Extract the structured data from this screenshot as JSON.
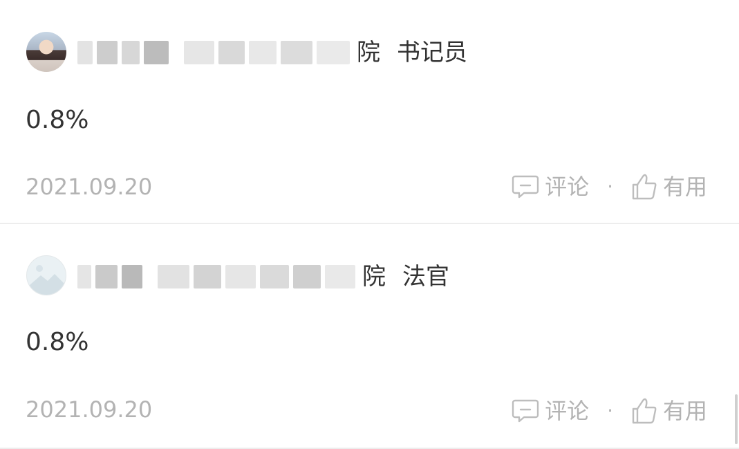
{
  "comments": [
    {
      "author_suffix": "院",
      "role": "书记员",
      "content": "0.8%",
      "date": "2021.09.20",
      "comment_label": "评论",
      "useful_label": "有用",
      "separator": "·"
    },
    {
      "author_suffix": "院",
      "role": "法官",
      "content": "0.8%",
      "date": "2021.09.20",
      "comment_label": "评论",
      "useful_label": "有用",
      "separator": "·"
    }
  ],
  "icons": {
    "comment": "comment-icon",
    "thumbs_up": "thumbs-up-icon"
  }
}
